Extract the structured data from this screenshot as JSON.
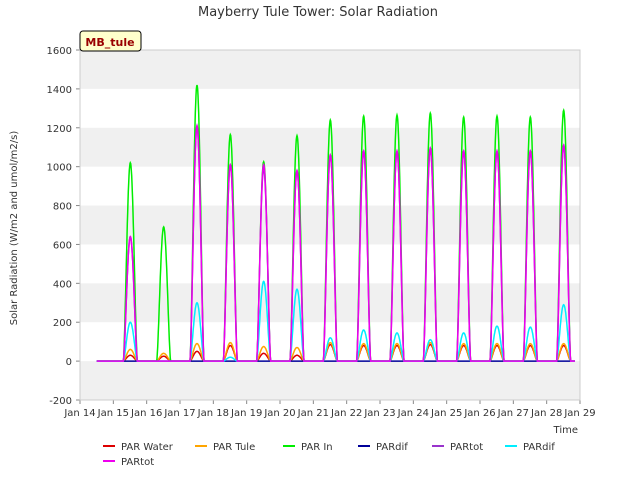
{
  "chart_data": {
    "type": "line",
    "title": "Mayberry Tule Tower: Solar Radiation",
    "station_label": "MB_tule",
    "xlabel": "Time",
    "ylabel": "Solar Radiation (W/m2 and umol/m2/s)",
    "xlim": [
      14,
      29
    ],
    "ylim": [
      -200,
      1600
    ],
    "x_ticks": [
      14,
      15,
      16,
      17,
      18,
      19,
      20,
      21,
      22,
      23,
      24,
      25,
      26,
      27,
      28,
      29
    ],
    "x_tick_labels": [
      "Jan 14",
      "Jan 15",
      "Jan 16",
      "Jan 17",
      "Jan 18",
      "Jan 19",
      "Jan 20",
      "Jan 21",
      "Jan 22",
      "Jan 23",
      "Jan 24",
      "Jan 25",
      "Jan 26",
      "Jan 27",
      "Jan 28",
      "Jan 29"
    ],
    "y_ticks": [
      -200,
      0,
      200,
      400,
      600,
      800,
      1000,
      1200,
      1400,
      1600
    ],
    "y_tick_labels": [
      "-200",
      "0",
      "200",
      "400",
      "600",
      "800",
      "1000",
      "1200",
      "1400",
      "1600"
    ],
    "grid": "horizontal bands",
    "legend_position": "bottom",
    "series": [
      {
        "name": "PAR Water",
        "color": "#dd0000",
        "daily_peaks": [
          [
            15,
            30
          ],
          [
            16,
            25
          ],
          [
            17,
            50
          ],
          [
            18,
            80
          ],
          [
            19,
            40
          ],
          [
            20,
            30
          ],
          [
            21,
            85
          ],
          [
            22,
            80
          ],
          [
            23,
            80
          ],
          [
            24,
            85
          ],
          [
            25,
            80
          ],
          [
            26,
            80
          ],
          [
            27,
            80
          ],
          [
            28,
            80
          ]
        ]
      },
      {
        "name": "PAR Tule",
        "color": "#ffa500",
        "daily_peaks": [
          [
            15,
            60
          ],
          [
            16,
            40
          ],
          [
            17,
            90
          ],
          [
            18,
            95
          ],
          [
            19,
            75
          ],
          [
            20,
            70
          ],
          [
            21,
            95
          ],
          [
            22,
            90
          ],
          [
            23,
            90
          ],
          [
            24,
            95
          ],
          [
            25,
            90
          ],
          [
            26,
            90
          ],
          [
            27,
            90
          ],
          [
            28,
            90
          ]
        ]
      },
      {
        "name": "PAR In",
        "color": "#00ee00",
        "daily_peaks": [
          [
            15,
            1020
          ],
          [
            16,
            690
          ],
          [
            17,
            1420
          ],
          [
            18,
            1165
          ],
          [
            19,
            1025
          ],
          [
            20,
            1160
          ],
          [
            21,
            1240
          ],
          [
            22,
            1260
          ],
          [
            23,
            1265
          ],
          [
            24,
            1275
          ],
          [
            25,
            1255
          ],
          [
            26,
            1260
          ],
          [
            27,
            1255
          ],
          [
            28,
            1290
          ]
        ]
      },
      {
        "name": "PARdif",
        "color": "#000099",
        "daily_peaks": [
          [
            15,
            0
          ],
          [
            16,
            0
          ],
          [
            17,
            0
          ],
          [
            18,
            0
          ],
          [
            19,
            0
          ],
          [
            20,
            0
          ],
          [
            21,
            0
          ],
          [
            22,
            0
          ],
          [
            23,
            0
          ],
          [
            24,
            0
          ],
          [
            25,
            0
          ],
          [
            26,
            0
          ],
          [
            27,
            0
          ],
          [
            28,
            0
          ]
        ]
      },
      {
        "name": "PARtot",
        "color": "#9933cc",
        "daily_peaks": [
          [
            15,
            640
          ],
          [
            16,
            0
          ],
          [
            17,
            1210
          ],
          [
            18,
            1010
          ],
          [
            19,
            990
          ],
          [
            20,
            980
          ],
          [
            21,
            1060
          ],
          [
            22,
            1080
          ],
          [
            23,
            1080
          ],
          [
            24,
            1095
          ],
          [
            25,
            1080
          ],
          [
            26,
            1080
          ],
          [
            27,
            1080
          ],
          [
            28,
            1110
          ]
        ]
      },
      {
        "name": "PARdif",
        "color": "#00eeff",
        "daily_peaks": [
          [
            15,
            200
          ],
          [
            16,
            0
          ],
          [
            17,
            300
          ],
          [
            18,
            20
          ],
          [
            19,
            410
          ],
          [
            20,
            370
          ],
          [
            21,
            120
          ],
          [
            22,
            160
          ],
          [
            23,
            145
          ],
          [
            24,
            110
          ],
          [
            25,
            145
          ],
          [
            26,
            180
          ],
          [
            27,
            175
          ],
          [
            28,
            290
          ]
        ]
      },
      {
        "name": "PARtot",
        "color": "#ee00ee",
        "daily_peaks": [
          [
            15,
            640
          ],
          [
            16,
            0
          ],
          [
            17,
            1210
          ],
          [
            18,
            1010
          ],
          [
            19,
            1010
          ],
          [
            20,
            980
          ],
          [
            21,
            1060
          ],
          [
            22,
            1080
          ],
          [
            23,
            1080
          ],
          [
            24,
            1095
          ],
          [
            25,
            1080
          ],
          [
            26,
            1080
          ],
          [
            27,
            1080
          ],
          [
            28,
            1110
          ]
        ]
      }
    ]
  }
}
